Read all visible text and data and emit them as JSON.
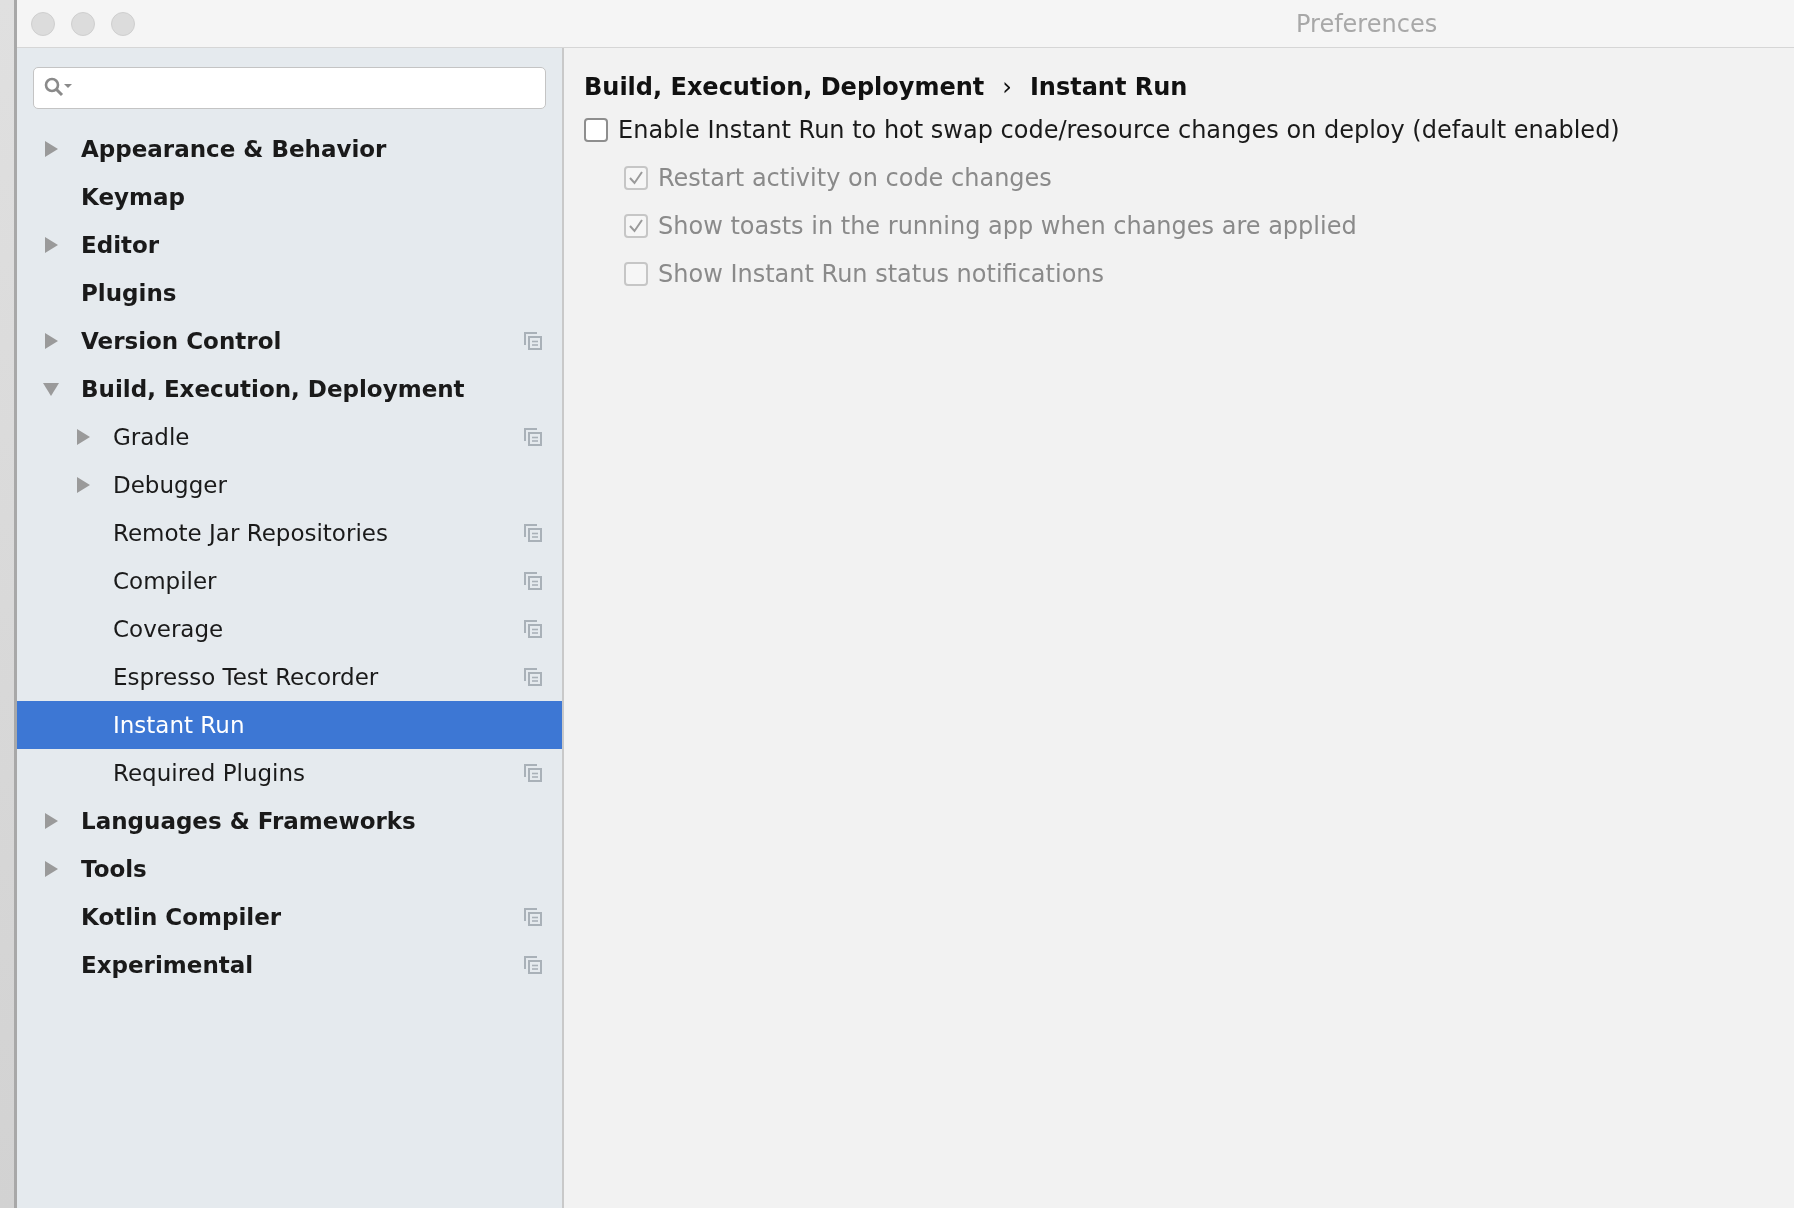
{
  "window": {
    "title": "Preferences"
  },
  "sidebar": {
    "items": [
      {
        "label": "Appearance & Behavior",
        "expanded": false,
        "selected": false,
        "project_scoped": false
      },
      {
        "label": "Keymap",
        "selected": false,
        "project_scoped": false
      },
      {
        "label": "Editor",
        "expanded": false,
        "selected": false,
        "project_scoped": false
      },
      {
        "label": "Plugins",
        "selected": false,
        "project_scoped": false
      },
      {
        "label": "Version Control",
        "expanded": false,
        "selected": false,
        "project_scoped": true
      },
      {
        "label": "Build, Execution, Deployment",
        "expanded": true,
        "selected": false,
        "project_scoped": false,
        "children": [
          {
            "label": "Gradle",
            "expanded": false,
            "selected": false,
            "project_scoped": true
          },
          {
            "label": "Debugger",
            "expanded": false,
            "selected": false,
            "project_scoped": false
          },
          {
            "label": "Remote Jar Repositories",
            "selected": false,
            "project_scoped": true
          },
          {
            "label": "Compiler",
            "selected": false,
            "project_scoped": true
          },
          {
            "label": "Coverage",
            "selected": false,
            "project_scoped": true
          },
          {
            "label": "Espresso Test Recorder",
            "selected": false,
            "project_scoped": true
          },
          {
            "label": "Instant Run",
            "selected": true,
            "project_scoped": false
          },
          {
            "label": "Required Plugins",
            "selected": false,
            "project_scoped": true
          }
        ]
      },
      {
        "label": "Languages & Frameworks",
        "expanded": false,
        "selected": false,
        "project_scoped": false
      },
      {
        "label": "Tools",
        "expanded": false,
        "selected": false,
        "project_scoped": false
      },
      {
        "label": "Kotlin Compiler",
        "selected": false,
        "project_scoped": true
      },
      {
        "label": "Experimental",
        "selected": false,
        "project_scoped": true
      }
    ]
  },
  "breadcrumb": {
    "items": [
      "Build, Execution, Deployment",
      "Instant Run"
    ],
    "separator": "›"
  },
  "options": [
    {
      "label": "Enable Instant Run to hot swap code/resource changes on deploy (default enabled)",
      "checked": false,
      "disabled": false,
      "children": [
        {
          "label": "Restart activity on code changes",
          "checked": true,
          "disabled": true
        },
        {
          "label": "Show toasts in the running app when changes are applied",
          "checked": true,
          "disabled": true
        },
        {
          "label": "Show Instant Run status notifications",
          "checked": false,
          "disabled": true
        }
      ]
    }
  ]
}
